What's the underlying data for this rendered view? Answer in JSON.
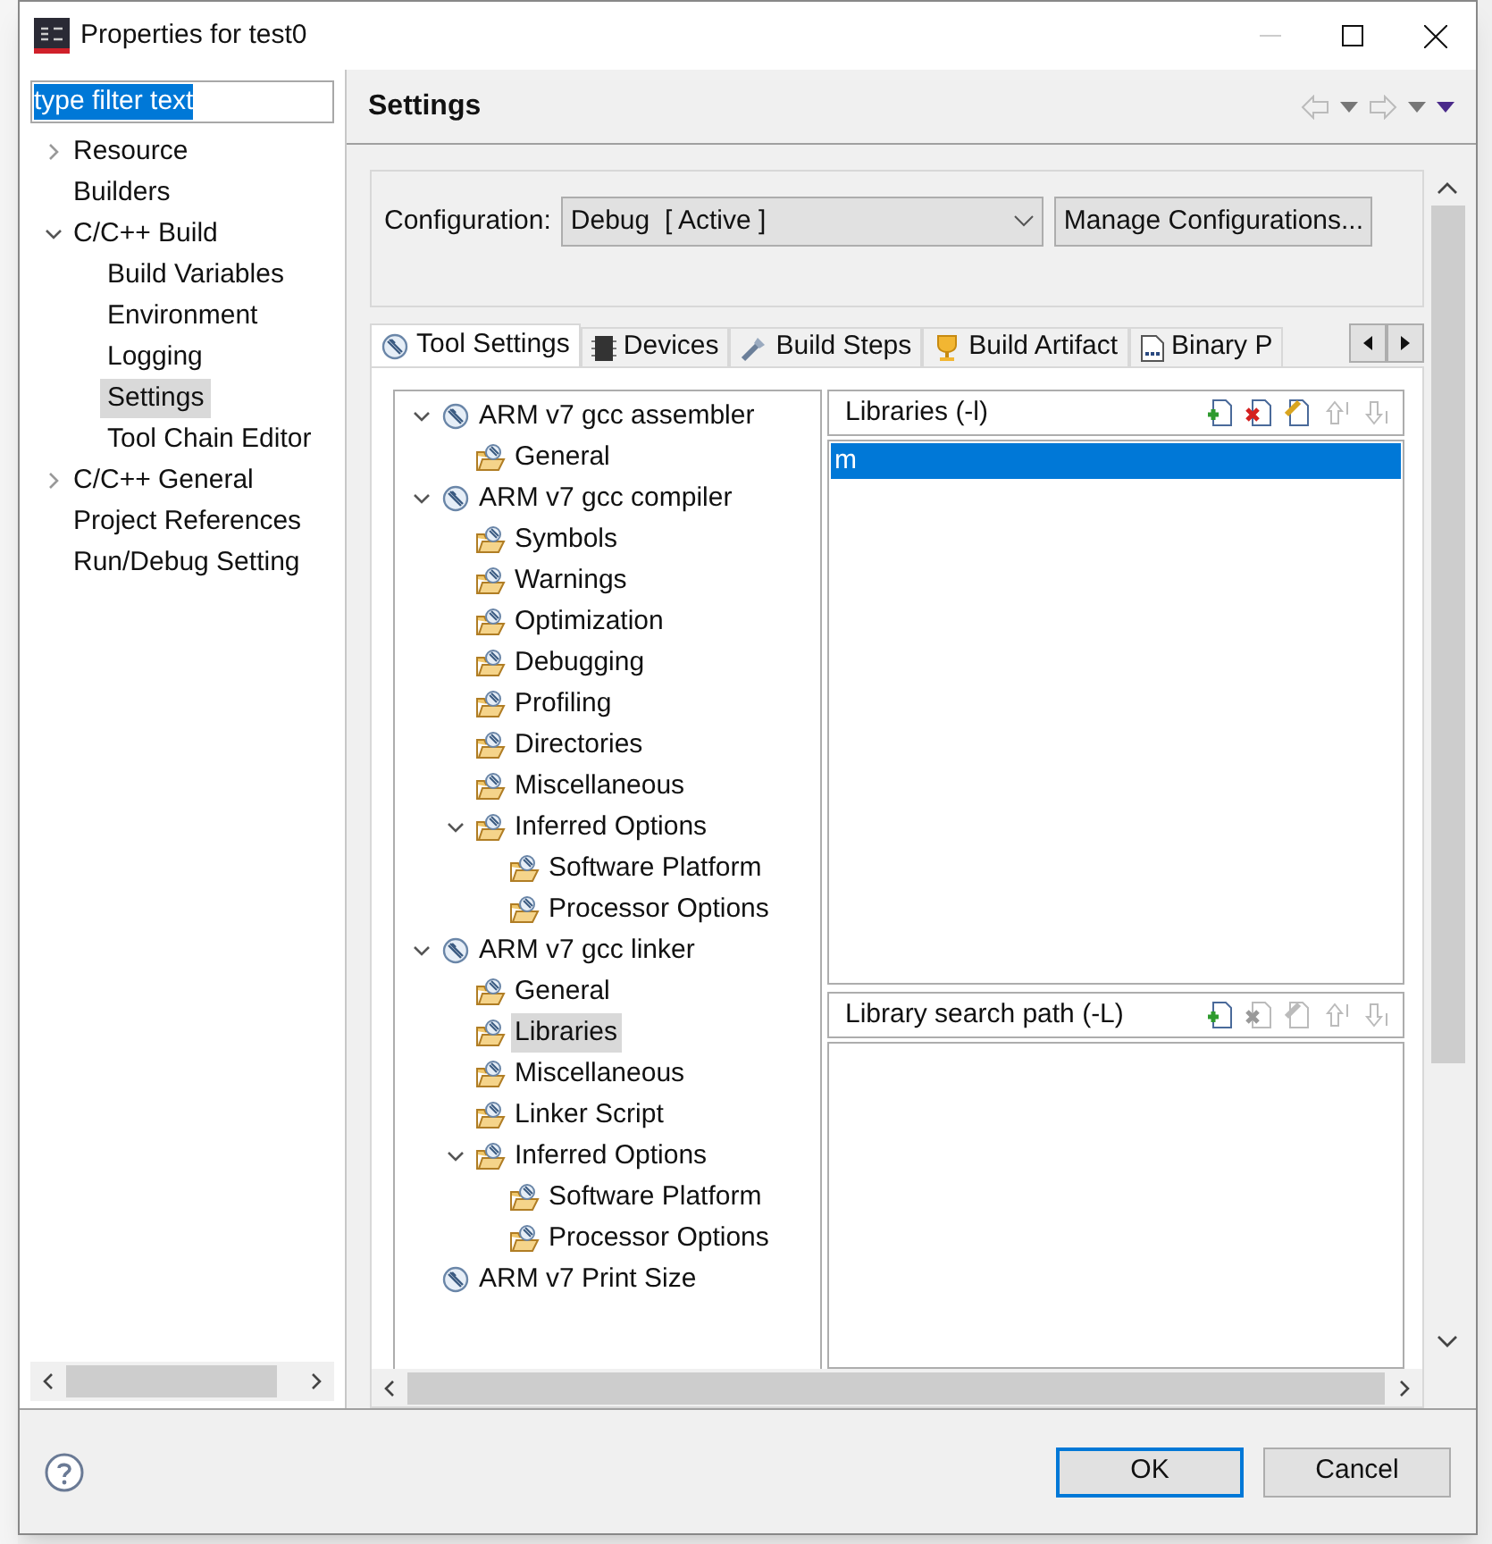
{
  "window": {
    "title": "Properties for test0"
  },
  "filter": {
    "value": "type filter text",
    "selected": true
  },
  "sidebar": {
    "items": [
      {
        "label": "Resource",
        "expanded": false,
        "selected": false
      },
      {
        "label": "Builders",
        "selected": false
      },
      {
        "label": "C/C++ Build",
        "expanded": true,
        "selected": false,
        "children": [
          {
            "label": "Build Variables",
            "selected": false
          },
          {
            "label": "Environment",
            "selected": false
          },
          {
            "label": "Logging",
            "selected": false
          },
          {
            "label": "Settings",
            "selected": true
          },
          {
            "label": "Tool Chain Editor",
            "selected": false
          }
        ]
      },
      {
        "label": "C/C++ General",
        "expanded": false,
        "selected": false
      },
      {
        "label": "Project References",
        "selected": false
      },
      {
        "label": "Run/Debug Setting",
        "selected": false
      }
    ]
  },
  "page": {
    "title": "Settings"
  },
  "configuration": {
    "label": "Configuration:",
    "value": "Debug  [ Active ]",
    "manage_button": "Manage Configurations..."
  },
  "tabs": [
    {
      "label": "Tool Settings",
      "kind": "tool",
      "selected": true
    },
    {
      "label": "Devices",
      "kind": "chip",
      "selected": false
    },
    {
      "label": "Build Steps",
      "kind": "steps",
      "selected": false
    },
    {
      "label": "Build Artifact",
      "kind": "trophy",
      "selected": false
    },
    {
      "label": "Binary P",
      "kind": "binary",
      "selected": false
    }
  ],
  "tool_tree": [
    {
      "label": "ARM v7 gcc assembler",
      "kind": "tool",
      "expanded": true,
      "selected": false,
      "children": [
        {
          "label": "General",
          "kind": "category",
          "selected": false
        }
      ]
    },
    {
      "label": "ARM v7 gcc compiler",
      "kind": "tool",
      "expanded": true,
      "selected": false,
      "children": [
        {
          "label": "Symbols",
          "kind": "category",
          "selected": false
        },
        {
          "label": "Warnings",
          "kind": "category",
          "selected": false
        },
        {
          "label": "Optimization",
          "kind": "category",
          "selected": false
        },
        {
          "label": "Debugging",
          "kind": "category",
          "selected": false
        },
        {
          "label": "Profiling",
          "kind": "category",
          "selected": false
        },
        {
          "label": "Directories",
          "kind": "category",
          "selected": false
        },
        {
          "label": "Miscellaneous",
          "kind": "category",
          "selected": false
        },
        {
          "label": "Inferred Options",
          "kind": "category",
          "expanded": true,
          "selected": false,
          "children": [
            {
              "label": "Software Platform",
              "kind": "category",
              "selected": false
            },
            {
              "label": "Processor Options",
              "kind": "category",
              "selected": false
            }
          ]
        }
      ]
    },
    {
      "label": "ARM v7 gcc linker",
      "kind": "tool",
      "expanded": true,
      "selected": false,
      "children": [
        {
          "label": "General",
          "kind": "category",
          "selected": false
        },
        {
          "label": "Libraries",
          "kind": "category",
          "selected": true
        },
        {
          "label": "Miscellaneous",
          "kind": "category",
          "selected": false
        },
        {
          "label": "Linker Script",
          "kind": "category",
          "selected": false
        },
        {
          "label": "Inferred Options",
          "kind": "category",
          "expanded": true,
          "selected": false,
          "children": [
            {
              "label": "Software Platform",
              "kind": "category",
              "selected": false
            },
            {
              "label": "Processor Options",
              "kind": "category",
              "selected": false
            }
          ]
        }
      ]
    },
    {
      "label": "ARM v7 Print Size",
      "kind": "tool",
      "selected": false
    }
  ],
  "lists": [
    {
      "title": "Libraries (-l)",
      "tools": [
        {
          "kind": "add",
          "disabled": false
        },
        {
          "kind": "delete",
          "disabled": false
        },
        {
          "kind": "edit",
          "disabled": false
        },
        {
          "kind": "up",
          "disabled": true
        },
        {
          "kind": "down",
          "disabled": true
        }
      ],
      "items": [
        {
          "text": "m",
          "selected": true
        }
      ]
    },
    {
      "title": "Library search path (-L)",
      "tools": [
        {
          "kind": "add",
          "disabled": false
        },
        {
          "kind": "delete",
          "disabled": true
        },
        {
          "kind": "edit",
          "disabled": true
        },
        {
          "kind": "up",
          "disabled": true
        },
        {
          "kind": "down",
          "disabled": true
        }
      ]
    }
  ],
  "buttons": [
    {
      "label": "OK",
      "default": true
    },
    {
      "label": "Cancel",
      "default": false
    }
  ]
}
